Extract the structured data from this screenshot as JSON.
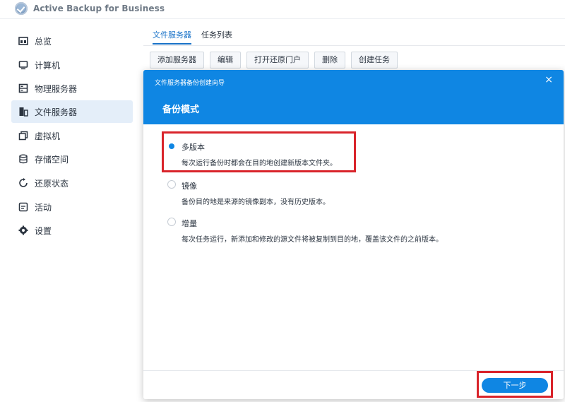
{
  "app": {
    "title": "Active Backup for Business",
    "logo_icon": "check-shield-icon"
  },
  "sidebar": {
    "items": [
      {
        "label": "总览",
        "icon": "overview-icon",
        "active": false
      },
      {
        "label": "计算机",
        "icon": "computer-icon",
        "active": false
      },
      {
        "label": "物理服务器",
        "icon": "server-icon",
        "active": false
      },
      {
        "label": "文件服务器",
        "icon": "file-server-icon",
        "active": true
      },
      {
        "label": "虚拟机",
        "icon": "virtual-machine-icon",
        "active": false
      },
      {
        "label": "存储空间",
        "icon": "storage-icon",
        "active": false
      },
      {
        "label": "还原状态",
        "icon": "restore-icon",
        "active": false
      },
      {
        "label": "活动",
        "icon": "activity-icon",
        "active": false
      },
      {
        "label": "设置",
        "icon": "gear-icon",
        "active": false
      }
    ]
  },
  "main": {
    "tabs": [
      {
        "label": "文件服务器",
        "active": true
      },
      {
        "label": "任务列表",
        "active": false
      }
    ],
    "toolbar": [
      "添加服务器",
      "编辑",
      "打开还原门户",
      "删除",
      "创建任务"
    ]
  },
  "dialog": {
    "wizard_title": "文件服务器备份创建向导",
    "close_glyph": "×",
    "step_title": "备份模式",
    "options": [
      {
        "label": "多版本",
        "desc": "每次运行备份时都会在目的地创建新版本文件夹。",
        "selected": true
      },
      {
        "label": "镜像",
        "desc": "备份目的地是来源的镜像副本，没有历史版本。",
        "selected": false
      },
      {
        "label": "增量",
        "desc": "每次任务运行，新添加和修改的源文件将被复制到目的地，覆盖该文件的之前版本。",
        "selected": false
      }
    ],
    "next_label": "下一步"
  },
  "colors": {
    "accent": "#0f86e3",
    "highlight": "#d9242b",
    "active_nav_bg": "#e4eef9"
  }
}
